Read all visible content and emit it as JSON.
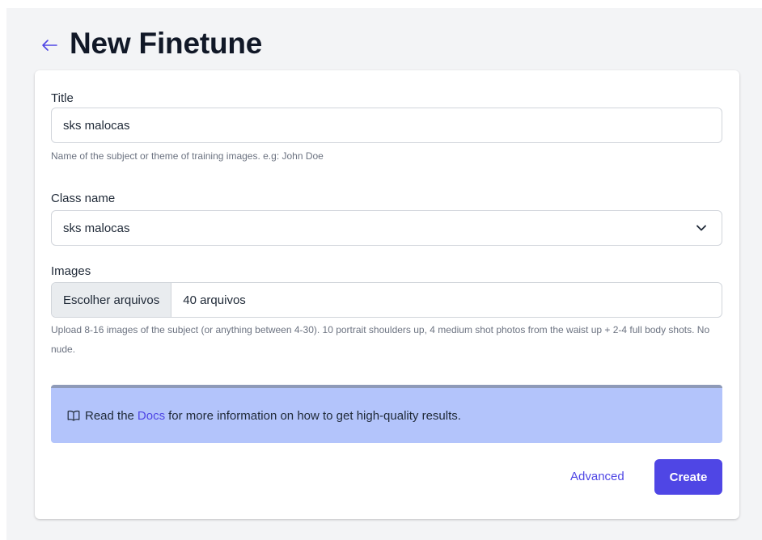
{
  "page": {
    "title": "New Finetune",
    "back_icon": "arrow-left-icon"
  },
  "form": {
    "title_field": {
      "label": "Title",
      "value": "sks malocas",
      "help": "Name of the subject or theme of training images. e.g: John Doe"
    },
    "class_field": {
      "label": "Class name",
      "selected": "sks malocas",
      "icon": "chevron-down-icon"
    },
    "images_field": {
      "label": "Images",
      "button_label": "Escolher arquivos",
      "status": "40 arquivos",
      "help": "Upload 8-16 images of the subject (or anything between 4-30). 10 portrait shoulders up, 4 medium shot photos from the waist up + 2-4 full body shots. No nude."
    },
    "info": {
      "icon": "book-open-icon",
      "prefix": "Read the",
      "link": "Docs",
      "suffix": "for more information on how to get high-quality results."
    },
    "actions": {
      "advanced_label": "Advanced",
      "create_label": "Create"
    }
  },
  "colors": {
    "accent": "#4f46e5",
    "info_background": "#b3c4fb",
    "page_background": "#f3f4f6"
  }
}
